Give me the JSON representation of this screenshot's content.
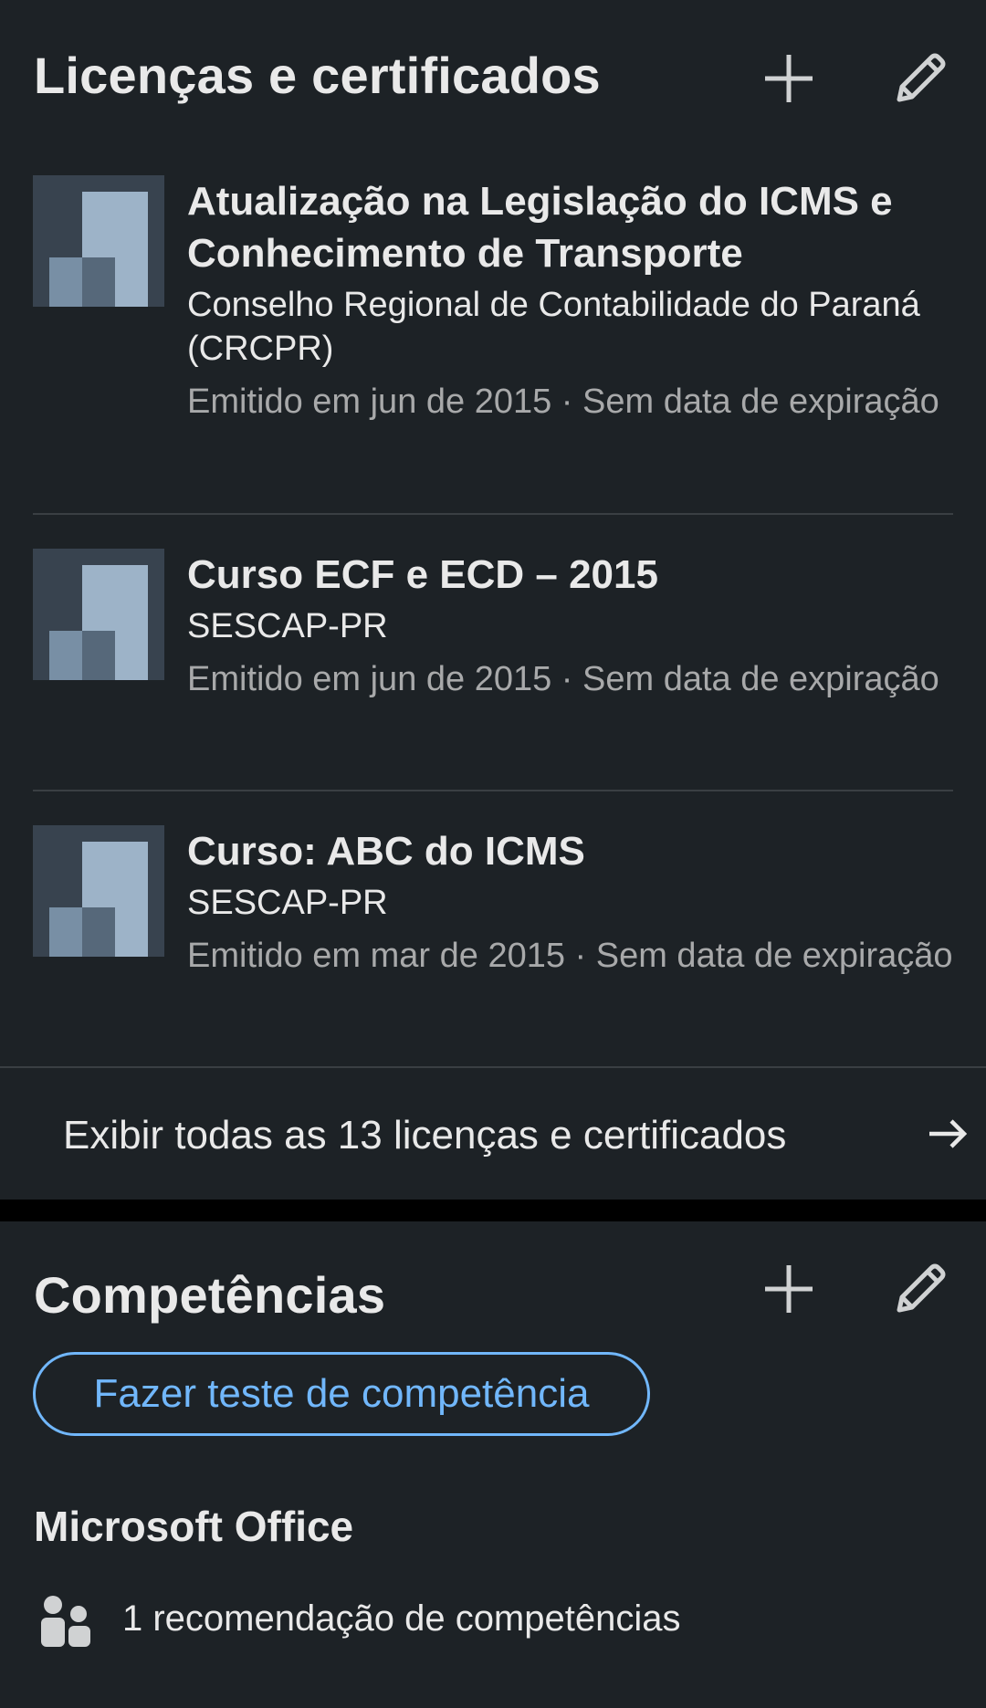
{
  "licenses": {
    "title": "Licenças e certificados",
    "items": [
      {
        "title": "Atualização na Legislação do ICMS e Conhecimento de Transporte",
        "issuer": "Conselho Regional de Contabilidade do Paraná (CRCPR)",
        "date": "Emitido em jun de 2015 · Sem data de expiração"
      },
      {
        "title": "Curso ECF e ECD – 2015",
        "issuer": "SESCAP-PR",
        "date": "Emitido em jun de 2015 · Sem data de expiração"
      },
      {
        "title": "Curso: ABC do ICMS",
        "issuer": "SESCAP-PR",
        "date": "Emitido em mar de 2015 · Sem data de expiração"
      }
    ],
    "show_all_label": "Exibir todas as 13 licenças e certificados"
  },
  "skills": {
    "title": "Competências",
    "test_button_label": "Fazer teste de competência",
    "items": [
      {
        "name": "Microsoft Office",
        "endorsements": "1 recomendação de competências"
      }
    ]
  },
  "icons": {
    "add": "plus-icon",
    "edit": "pencil-icon",
    "arrow": "arrow-right-icon",
    "people": "people-icon",
    "logo": "company-logo-placeholder"
  },
  "colors": {
    "card_background": "#1d2226",
    "page_background": "#000000",
    "primary_text": "#e9e9e9",
    "secondary_text": "#a8a9aa",
    "accent": "#71b7fb"
  }
}
